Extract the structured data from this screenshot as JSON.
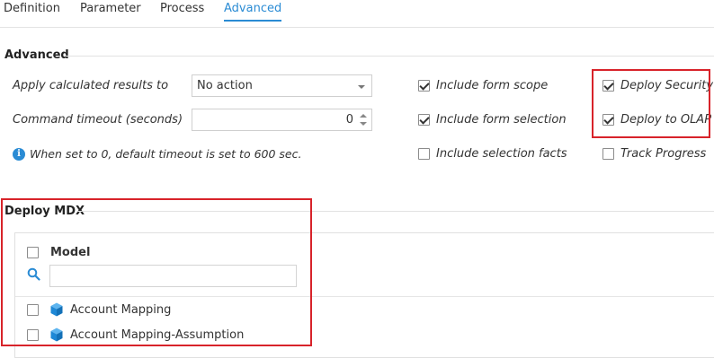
{
  "tabs": [
    {
      "label": "Definition"
    },
    {
      "label": "Parameter"
    },
    {
      "label": "Process"
    },
    {
      "label": "Advanced"
    }
  ],
  "advanced": {
    "title": "Advanced",
    "apply_label": "Apply calculated results to",
    "apply_value": "No action",
    "timeout_label": "Command timeout (seconds)",
    "timeout_value": "0",
    "hint": "When set to 0, default timeout is set to 600 sec.",
    "checkboxes": [
      {
        "label": "Include form scope",
        "checked": true
      },
      {
        "label": "Include form selection",
        "checked": true
      },
      {
        "label": "Include selection facts",
        "checked": false
      },
      {
        "label": "Deploy Security",
        "checked": true
      },
      {
        "label": "Deploy to OLAP",
        "checked": true
      },
      {
        "label": "Track Progress",
        "checked": false
      }
    ]
  },
  "deploy_mdx": {
    "title": "Deploy MDX",
    "column_header": "Model",
    "search_value": "",
    "rows": [
      {
        "label": "Account Mapping",
        "checked": false
      },
      {
        "label": "Account Mapping-Assumption",
        "checked": false
      }
    ]
  },
  "colors": {
    "accent": "#2a8bd4",
    "highlight_box": "#d8232a",
    "cube_icon": "#1e88d6"
  },
  "icons": {
    "info": "info-icon",
    "search": "search-icon",
    "model": "cube-icon"
  }
}
